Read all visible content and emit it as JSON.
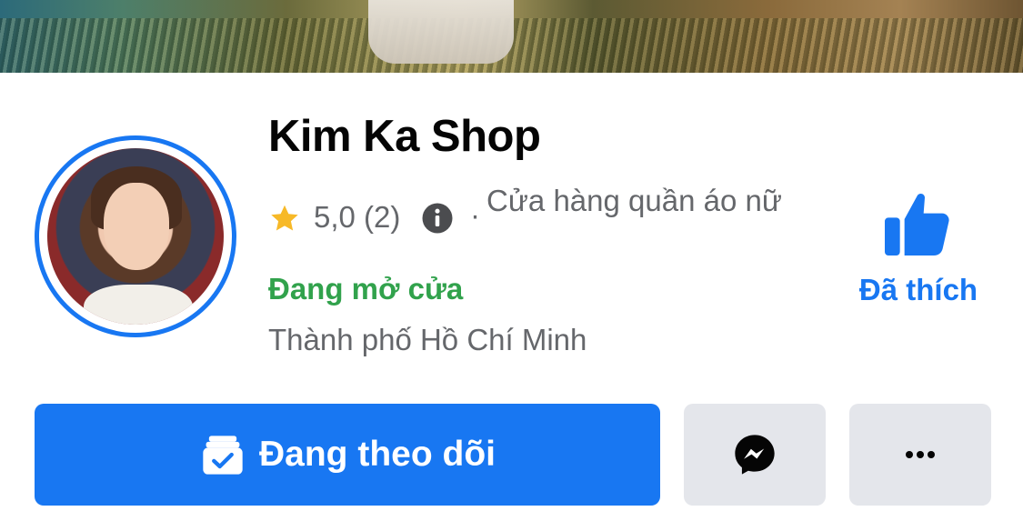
{
  "page": {
    "name": "Kim Ka Shop",
    "rating": "5,0 (2)",
    "separator": "·",
    "category": "Cửa hàng quần áo nữ",
    "open_status": "Đang mở cửa",
    "location": "Thành phố Hồ Chí Minh"
  },
  "like": {
    "label": "Đã thích"
  },
  "actions": {
    "follow_label": "Đang theo dõi",
    "messenger_icon": "messenger-icon",
    "more_icon": "more-icon"
  },
  "colors": {
    "accent": "#1877f2",
    "open_status": "#31a24c",
    "secondary_text": "#65676b",
    "button_gray": "#e4e6eb",
    "star": "#f7b928"
  }
}
